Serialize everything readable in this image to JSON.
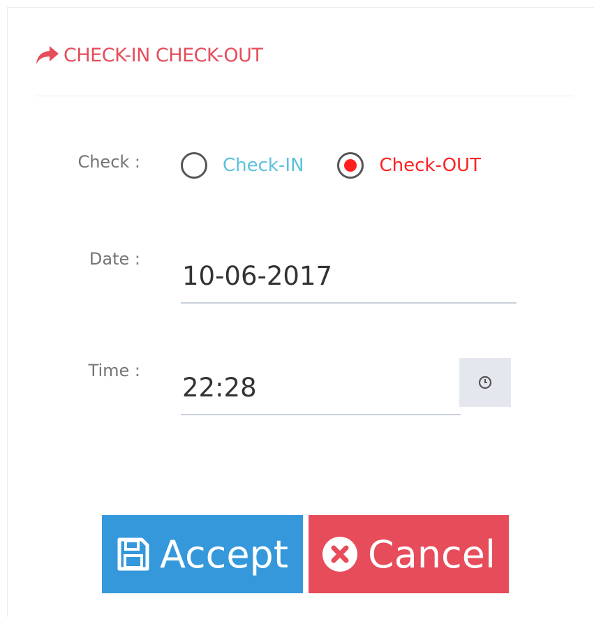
{
  "header": {
    "title": "CHECK-IN CHECK-OUT",
    "icon": "share-arrow-icon"
  },
  "form": {
    "check": {
      "label": "Check :",
      "options": [
        {
          "label": "Check-IN",
          "selected": false,
          "color": "#5bc0de"
        },
        {
          "label": "Check-OUT",
          "selected": true,
          "color": "#ff2121"
        }
      ]
    },
    "date": {
      "label": "Date :",
      "value": "10-06-2017"
    },
    "time": {
      "label": "Time :",
      "value": "22:28",
      "addon_icon": "clock-icon"
    }
  },
  "buttons": {
    "accept": {
      "label": "Accept",
      "icon": "save-icon",
      "color": "#3498db"
    },
    "cancel": {
      "label": "Cancel",
      "icon": "close-circle-icon",
      "color": "#e74c5a"
    }
  },
  "colors": {
    "accent": "#e54d5b",
    "label_gray": "#757575"
  }
}
